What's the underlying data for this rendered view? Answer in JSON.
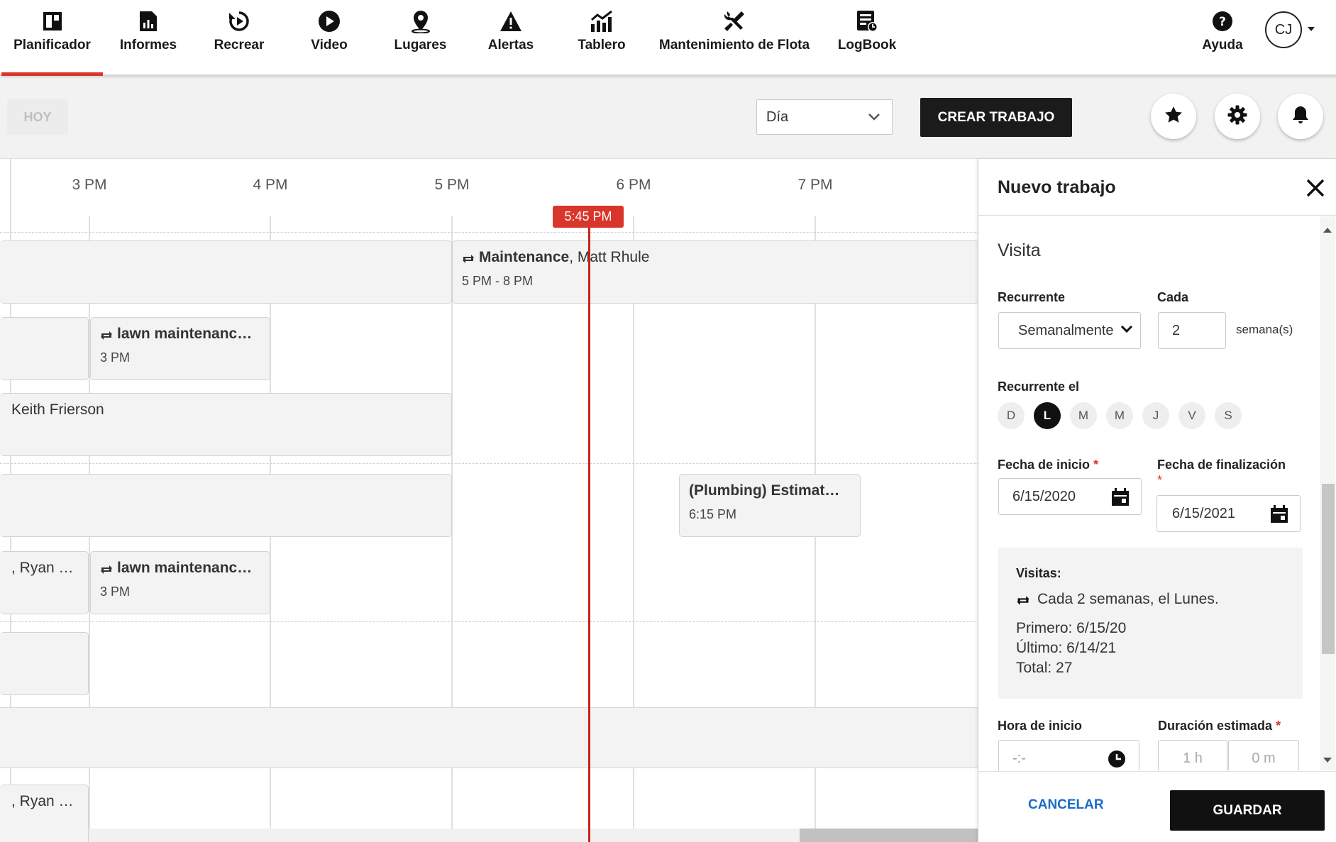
{
  "nav": {
    "items": [
      {
        "label": "Planificador",
        "icon": "planner-icon",
        "active": true
      },
      {
        "label": "Informes",
        "icon": "reports-icon"
      },
      {
        "label": "Recrear",
        "icon": "replay-icon"
      },
      {
        "label": "Video",
        "icon": "play-icon"
      },
      {
        "label": "Lugares",
        "icon": "location-pin-icon"
      },
      {
        "label": "Alertas",
        "icon": "warning-icon"
      },
      {
        "label": "Tablero",
        "icon": "dashboard-chart-icon"
      },
      {
        "label": "Mantenimiento de Flota",
        "icon": "wrench-screwdriver-icon"
      },
      {
        "label": "LogBook",
        "icon": "logbook-icon"
      }
    ],
    "help_label": "Ayuda",
    "avatar_initials": "CJ",
    "accent_color": "#d9362b"
  },
  "toolbar": {
    "today_label": "HOY",
    "view_value": "Día",
    "create_job_label": "CREAR TRABAJO"
  },
  "schedule": {
    "hours": [
      "3 PM",
      "4 PM",
      "5 PM",
      "6 PM",
      "7 PM"
    ],
    "now_label": "5:45 PM",
    "events": [
      {
        "title_bold": "Maintenance",
        "title_rest": ", Matt Rhule",
        "time": "5 PM - 8 PM",
        "recurring": true
      },
      {
        "title_bold": "lawn maintenanc…",
        "title_rest": "",
        "time": "3 PM",
        "recurring": true
      },
      {
        "title_bold": "",
        "title_rest": "Keith Frierson",
        "time": "",
        "recurring": false
      },
      {
        "title_bold": "(Plumbing) Estimat…",
        "title_rest": "",
        "time": "6:15 PM",
        "recurring": false
      },
      {
        "title_bold": "",
        "title_rest": ", Ryan …",
        "time": "",
        "recurring": false
      },
      {
        "title_bold": "lawn maintenanc…",
        "title_rest": "",
        "time": "3 PM",
        "recurring": true
      },
      {
        "title_bold": "",
        "title_rest": ", Ryan …",
        "time": "",
        "recurring": false
      }
    ]
  },
  "panel": {
    "title": "Nuevo trabajo",
    "section_title": "Visita",
    "recurrence_label": "Recurrente",
    "recurrence_value": "Semanalmente",
    "every_label": "Cada",
    "every_value": "2",
    "every_unit": "semana(s)",
    "recurs_on_label": "Recurrente el",
    "days": [
      "D",
      "L",
      "M",
      "M",
      "J",
      "V",
      "S"
    ],
    "selected_day_index": 1,
    "start_date_label": "Fecha de inicio",
    "start_date_value": "6/15/2020",
    "end_date_label": "Fecha de finalización",
    "end_date_value": "6/15/2021",
    "required_mark": "*",
    "visits": {
      "label": "Visitas:",
      "summary": "Cada 2 semanas, el Lunes.",
      "first": "Primero: 6/15/20",
      "last": "Último: 6/14/21",
      "total": "Total: 27"
    },
    "start_time_label": "Hora de inicio",
    "start_time_placeholder": "-:-",
    "duration_label": "Duración estimada",
    "duration_hours_placeholder": "1 h",
    "duration_minutes_placeholder": "0 m",
    "cancel_label": "CANCELAR",
    "save_label": "GUARDAR"
  }
}
